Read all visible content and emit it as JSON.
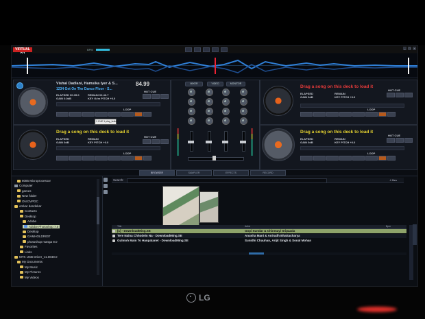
{
  "app": {
    "logo": "VIRTUAL DJ",
    "topbar_text": "BPM"
  },
  "deck_left_top": {
    "title": "Vishal Dadlani, Hamsika Iyer & S...",
    "subtitle": "1234 Get On The Dance Floor - S...",
    "bpm": "84.99",
    "elapsed_label": "ELAPSED 00:35.0",
    "remain_label": "REMAIN 03:46.7",
    "gain_label": "GAIN 0.0dB",
    "key_label": "KEY G#m PITCH +0.0",
    "hot_cue": "HOT CUE",
    "loop": "LOOP",
    "tooltip": "1 CUE 1 play_button"
  },
  "deck_left_bottom": {
    "message": "Drag a song on this deck to load it",
    "elapsed": "ELAPSED",
    "remain": "REMAIN",
    "gain": "GAIN 0dB",
    "key_pitch": "KEY   PITCH +0.0",
    "hot_cue": "HOT CUE",
    "loop": "LOOP"
  },
  "deck_right_top": {
    "message": "Drag a song on this deck to load it",
    "elapsed": "ELAPSED",
    "remain": "REMAIN",
    "gain": "GAIN 0dB",
    "key_pitch": "KEY   PITCH +0.0",
    "hot_cue": "HOT CUE",
    "loop": "LOOP"
  },
  "deck_right_bottom": {
    "message": "Drag a song on this deck to load it",
    "elapsed": "ELAPSED",
    "remain": "REMAIN",
    "gain": "GAIN 0dB",
    "key_pitch": "KEY   PITCH +0.0",
    "hot_cue": "HOT CUE",
    "loop": "LOOP"
  },
  "mixer": {
    "tabs": [
      "MIXER",
      "VIDEO",
      "MONITOR"
    ]
  },
  "view_tabs": [
    "BROWSER",
    "SAMPLER",
    "EFFECTS",
    "RECORD"
  ],
  "folders": [
    {
      "label": "8085 Microprocessor",
      "icon": "folder"
    },
    {
      "label": "Computer",
      "icon": "drive"
    },
    {
      "label": "games",
      "icon": "folder"
    },
    {
      "label": "New folder",
      "icon": "folder"
    },
    {
      "label": "ON DVPDC",
      "icon": "folder"
    },
    {
      "label": "omkar dandekar",
      "icon": "folder"
    },
    {
      "label": "Contacts",
      "icon": "folder"
    },
    {
      "label": "Desktop",
      "icon": "folder"
    },
    {
      "label": "Adobe",
      "icon": "folder"
    },
    {
      "label": "Adobe Photoshop 7.0",
      "icon": "folder"
    },
    {
      "label": "Desktop",
      "icon": "folder"
    },
    {
      "label": "GAMHOLDR007",
      "icon": "folder"
    },
    {
      "label": "photoshop manga 8.0",
      "icon": "folder"
    },
    {
      "label": "Favorites",
      "icon": "folder"
    },
    {
      "label": "Links",
      "icon": "folder"
    },
    {
      "label": "MTK USB Driver_v1.0848.0",
      "icon": "folder"
    },
    {
      "label": "My Documents",
      "icon": "folder"
    },
    {
      "label": "My Music",
      "icon": "folder"
    },
    {
      "label": "My Pictures",
      "icon": "folder"
    },
    {
      "label": "My Videos",
      "icon": "folder"
    }
  ],
  "search": {
    "label": "Search:",
    "value": "",
    "files_count": "4 files"
  },
  "file_columns": {
    "title": "Title",
    "artist": "Artist",
    "bpm": "Bpm"
  },
  "files": [
    {
      "title": "[1]  - DownloadMing.SE",
      "artist": "Gopi Sundar & Chinmayi Sripaada",
      "selected": true
    },
    {
      "title": "Tere Naina Chhodein Na - DownloadMing.SE",
      "artist": "Anusha Mani & Anirudh Bhattacharya",
      "selected": false
    },
    {
      "title": "Gulmoh Main To Hanpatanet - DownloadMing.SE",
      "artist": "Sunidhi Chauhan, Arijit Singh & Sonal Mohan",
      "selected": false
    }
  ],
  "monitor_brand": "LG"
}
